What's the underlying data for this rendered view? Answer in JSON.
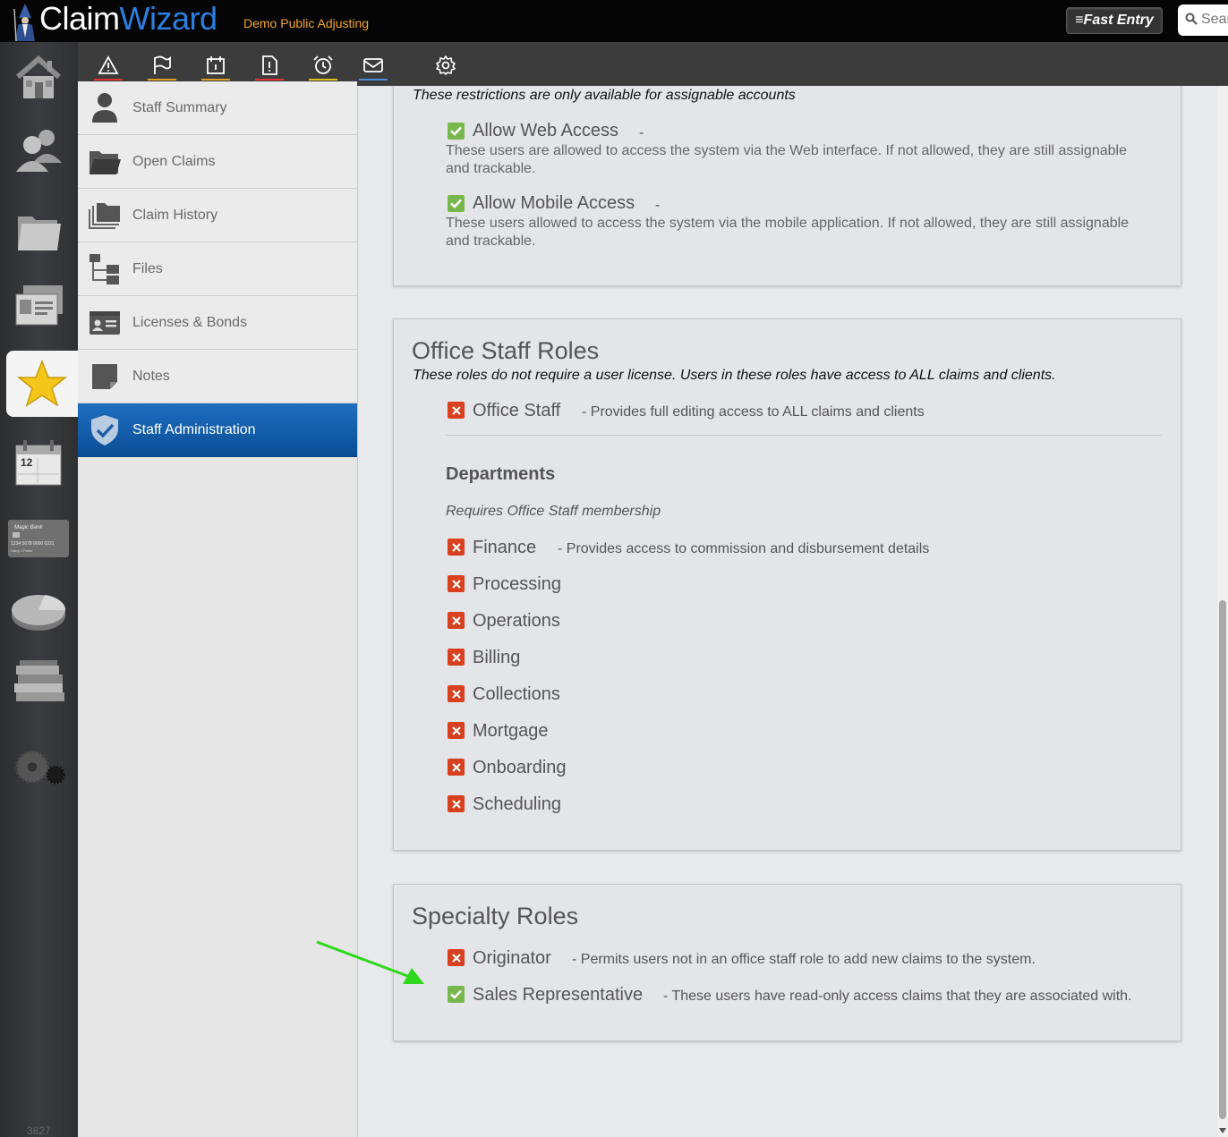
{
  "header": {
    "logo_claim": "Claim",
    "logo_wizard": "Wizard",
    "company": "Demo Public Adjusting",
    "fast_entry": "≡Fast Entry",
    "search_placeholder": "Search"
  },
  "rail": {
    "items": [
      "home-icon",
      "contacts-icon",
      "folder-icon",
      "cards-icon",
      "star-icon",
      "calendar-icon",
      "bank-card-icon",
      "pie-chart-icon",
      "books-icon",
      "gears-icon"
    ],
    "active": "star-icon",
    "count": "3827"
  },
  "toolbar": {
    "icons": [
      {
        "name": "alert-icon",
        "underline": "#d33"
      },
      {
        "name": "flag-icon",
        "underline": "#e0a020"
      },
      {
        "name": "calendar-task-icon",
        "underline": "#e0a020"
      },
      {
        "name": "document-alert-icon",
        "underline": "#d33"
      },
      {
        "name": "alarm-clock-icon",
        "underline": "#e0c020"
      },
      {
        "name": "mail-icon",
        "underline": "#4a8fd8"
      },
      {
        "name": "settings-icon",
        "underline": ""
      }
    ]
  },
  "submenu": {
    "items": [
      {
        "label": "Staff Summary",
        "icon": "person-icon"
      },
      {
        "label": "Open Claims",
        "icon": "open-folder-icon"
      },
      {
        "label": "Claim History",
        "icon": "folders-icon"
      },
      {
        "label": "Files",
        "icon": "file-tree-icon"
      },
      {
        "label": "Licenses & Bonds",
        "icon": "id-card-icon"
      },
      {
        "label": "Notes",
        "icon": "note-icon"
      },
      {
        "label": "Staff Administration",
        "icon": "shield-check-icon"
      }
    ],
    "active": "Staff Administration"
  },
  "access_panel": {
    "note": "These restrictions are only available for assignable accounts",
    "options": [
      {
        "label": "Allow Web Access",
        "checked": true,
        "desc": "-",
        "help": "These users are allowed to access the system via the Web interface. If not allowed, they are still assignable and trackable."
      },
      {
        "label": "Allow Mobile Access",
        "checked": true,
        "desc": "-",
        "help": "These users allowed to access the system via the mobile application. If not allowed, they are still assignable and trackable."
      }
    ]
  },
  "office_panel": {
    "title": "Office Staff Roles",
    "note": "These roles do not require a user license. Users in these roles have access to ALL claims and clients.",
    "office_staff": {
      "label": "Office Staff",
      "checked": false,
      "desc": "- Provides full editing access to ALL claims and clients"
    },
    "departments_title": "Departments",
    "departments_note": "Requires Office Staff membership",
    "departments": [
      {
        "label": "Finance",
        "checked": false,
        "desc": "- Provides access to commission and disbursement details"
      },
      {
        "label": "Processing",
        "checked": false,
        "desc": ""
      },
      {
        "label": "Operations",
        "checked": false,
        "desc": ""
      },
      {
        "label": "Billing",
        "checked": false,
        "desc": ""
      },
      {
        "label": "Collections",
        "checked": false,
        "desc": ""
      },
      {
        "label": "Mortgage",
        "checked": false,
        "desc": ""
      },
      {
        "label": "Onboarding",
        "checked": false,
        "desc": ""
      },
      {
        "label": "Scheduling",
        "checked": false,
        "desc": ""
      }
    ]
  },
  "specialty_panel": {
    "title": "Specialty Roles",
    "roles": [
      {
        "label": "Originator",
        "checked": false,
        "desc": "- Permits users not in an office staff role to add new claims to the system."
      },
      {
        "label": "Sales Representative",
        "checked": true,
        "desc": "- These users have read-only access claims that they are associated with."
      }
    ]
  },
  "colors": {
    "check_on": "#77b84c",
    "check_off": "#d9401f",
    "accent_blue": "#1f6fbf",
    "annotation_arrow": "#2ed81c"
  }
}
